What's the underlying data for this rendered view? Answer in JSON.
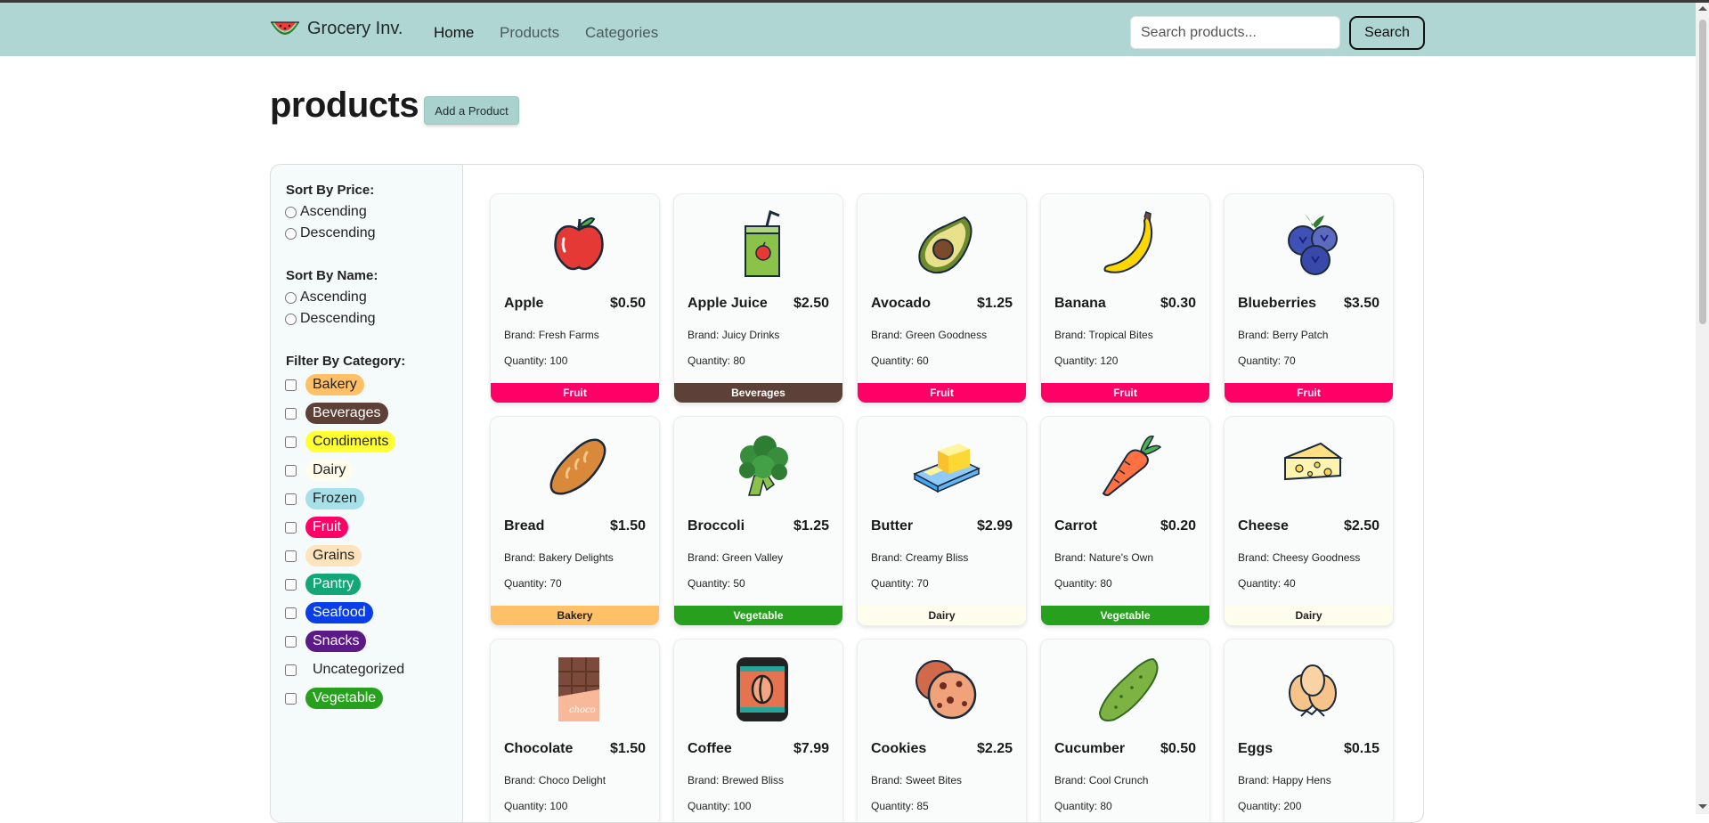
{
  "navbar": {
    "brand": "Grocery Inv.",
    "links": [
      {
        "label": "Home",
        "active": true
      },
      {
        "label": "Products",
        "active": false
      },
      {
        "label": "Categories",
        "active": false
      }
    ],
    "search_placeholder": "Search products...",
    "search_button": "Search"
  },
  "page": {
    "title": "products",
    "add_button": "Add a Product"
  },
  "sidebar": {
    "sort_price": {
      "title": "Sort By Price:",
      "options": [
        "Ascending",
        "Descending"
      ]
    },
    "sort_name": {
      "title": "Sort By Name:",
      "options": [
        "Ascending",
        "Descending"
      ]
    },
    "filter": {
      "title": "Filter By Category:",
      "categories": [
        {
          "label": "Bakery",
          "bg": "#ffc067",
          "fg": "#222222"
        },
        {
          "label": "Beverages",
          "bg": "#5d4037",
          "fg": "#ffffff"
        },
        {
          "label": "Condiments",
          "bg": "#ffff33",
          "fg": "#222222"
        },
        {
          "label": "Dairy",
          "bg": "#fffdeb",
          "fg": "#222222"
        },
        {
          "label": "Frozen",
          "bg": "#a8e0ea",
          "fg": "#222222"
        },
        {
          "label": "Fruit",
          "bg": "#ff0066",
          "fg": "#ffffff"
        },
        {
          "label": "Grains",
          "bg": "#ffe3bd",
          "fg": "#222222"
        },
        {
          "label": "Pantry",
          "bg": "#13a777",
          "fg": "#ffffff"
        },
        {
          "label": "Seafood",
          "bg": "#0a3fe8",
          "fg": "#ffffff"
        },
        {
          "label": "Snacks",
          "bg": "#5b1a87",
          "fg": "#ffffff"
        },
        {
          "label": "Uncategorized",
          "bg": "transparent",
          "fg": "#222222"
        },
        {
          "label": "Vegetable",
          "bg": "#27a11d",
          "fg": "#ffffff"
        }
      ]
    }
  },
  "products": [
    {
      "name": "Apple",
      "price": "$0.50",
      "brand": "Brand: Fresh Farms",
      "quantity": "Quantity: 100",
      "category": "Fruit",
      "cat_bg": "#ff0066",
      "cat_fg": "#ffffff",
      "icon": "apple-icon"
    },
    {
      "name": "Apple Juice",
      "price": "$2.50",
      "brand": "Brand: Juicy Drinks",
      "quantity": "Quantity: 80",
      "category": "Beverages",
      "cat_bg": "#5d4037",
      "cat_fg": "#ffffff",
      "icon": "juice-box-icon"
    },
    {
      "name": "Avocado",
      "price": "$1.25",
      "brand": "Brand: Green Goodness",
      "quantity": "Quantity: 60",
      "category": "Fruit",
      "cat_bg": "#ff0066",
      "cat_fg": "#ffffff",
      "icon": "avocado-icon"
    },
    {
      "name": "Banana",
      "price": "$0.30",
      "brand": "Brand: Tropical Bites",
      "quantity": "Quantity: 120",
      "category": "Fruit",
      "cat_bg": "#ff0066",
      "cat_fg": "#ffffff",
      "icon": "banana-icon"
    },
    {
      "name": "Blueberries",
      "price": "$3.50",
      "brand": "Brand: Berry Patch",
      "quantity": "Quantity: 70",
      "category": "Fruit",
      "cat_bg": "#ff0066",
      "cat_fg": "#ffffff",
      "icon": "blueberries-icon"
    },
    {
      "name": "Bread",
      "price": "$1.50",
      "brand": "Brand: Bakery Delights",
      "quantity": "Quantity: 70",
      "category": "Bakery",
      "cat_bg": "#ffc067",
      "cat_fg": "#222222",
      "icon": "bread-icon"
    },
    {
      "name": "Broccoli",
      "price": "$1.25",
      "brand": "Brand: Green Valley",
      "quantity": "Quantity: 50",
      "category": "Vegetable",
      "cat_bg": "#27a11d",
      "cat_fg": "#ffffff",
      "icon": "broccoli-icon"
    },
    {
      "name": "Butter",
      "price": "$2.99",
      "brand": "Brand: Creamy Bliss",
      "quantity": "Quantity: 70",
      "category": "Dairy",
      "cat_bg": "#fffdeb",
      "cat_fg": "#222222",
      "icon": "butter-icon"
    },
    {
      "name": "Carrot",
      "price": "$0.20",
      "brand": "Brand: Nature's Own",
      "quantity": "Quantity: 80",
      "category": "Vegetable",
      "cat_bg": "#27a11d",
      "cat_fg": "#ffffff",
      "icon": "carrot-icon"
    },
    {
      "name": "Cheese",
      "price": "$2.50",
      "brand": "Brand: Cheesy Goodness",
      "quantity": "Quantity: 40",
      "category": "Dairy",
      "cat_bg": "#fffdeb",
      "cat_fg": "#222222",
      "icon": "cheese-icon"
    },
    {
      "name": "Chocolate",
      "price": "$1.50",
      "brand": "Brand: Choco Delight",
      "quantity": "Quantity: 100",
      "category": "",
      "cat_bg": "#ffffff",
      "cat_fg": "#222222",
      "icon": "chocolate-icon"
    },
    {
      "name": "Coffee",
      "price": "$7.99",
      "brand": "Brand: Brewed Bliss",
      "quantity": "Quantity: 100",
      "category": "",
      "cat_bg": "#ffffff",
      "cat_fg": "#222222",
      "icon": "coffee-bag-icon"
    },
    {
      "name": "Cookies",
      "price": "$2.25",
      "brand": "Brand: Sweet Bites",
      "quantity": "Quantity: 85",
      "category": "",
      "cat_bg": "#ffffff",
      "cat_fg": "#222222",
      "icon": "cookies-icon"
    },
    {
      "name": "Cucumber",
      "price": "$0.50",
      "brand": "Brand: Cool Crunch",
      "quantity": "Quantity: 80",
      "category": "",
      "cat_bg": "#ffffff",
      "cat_fg": "#222222",
      "icon": "cucumber-icon"
    },
    {
      "name": "Eggs",
      "price": "$0.15",
      "brand": "Brand: Happy Hens",
      "quantity": "Quantity: 200",
      "category": "",
      "cat_bg": "#ffffff",
      "cat_fg": "#222222",
      "icon": "eggs-icon"
    }
  ]
}
